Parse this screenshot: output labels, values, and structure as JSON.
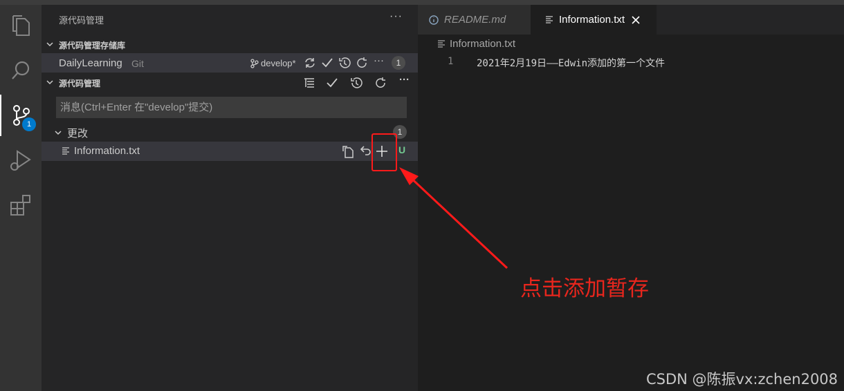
{
  "sidebar": {
    "title": "源代码管理",
    "providers_header": "源代码管理存储库",
    "repository": {
      "name": "DailyLearning",
      "type": "Git",
      "branch": "develop*",
      "count": "1"
    },
    "scm_header": "源代码管理",
    "commit_message": {
      "placeholder": "消息(Ctrl+Enter 在\"develop\"提交)",
      "value": ""
    },
    "changes": {
      "label": "更改",
      "count": "1"
    },
    "files": [
      {
        "name": "Information.txt",
        "status": "U"
      }
    ]
  },
  "activity_bar": {
    "scm_badge": "1"
  },
  "editor": {
    "tabs": [
      {
        "label": "README.md",
        "active": false
      },
      {
        "label": "Information.txt",
        "active": true
      }
    ],
    "breadcrumb": "Information.txt",
    "lines": [
      {
        "number": "1",
        "text": "2021年2月19日——Edwin添加的第一个文件"
      }
    ]
  },
  "annotation": {
    "text": "点击添加暂存",
    "color": "#e8261d"
  },
  "watermark": "CSDN @陈振vx:zchen2008",
  "colors": {
    "accent": "#007acc",
    "untracked": "#73c991",
    "highlight": "#ff1a1a"
  },
  "icons": [
    "files-icon",
    "search-icon",
    "source-control-icon",
    "run-debug-icon",
    "extensions-icon",
    "branch-icon",
    "sync-icon",
    "check-icon",
    "history-icon",
    "refresh-icon",
    "more-icon",
    "tree-view-icon",
    "open-file-icon",
    "discard-icon",
    "plus-icon",
    "info-icon",
    "close-icon",
    "chevron-down-icon"
  ]
}
